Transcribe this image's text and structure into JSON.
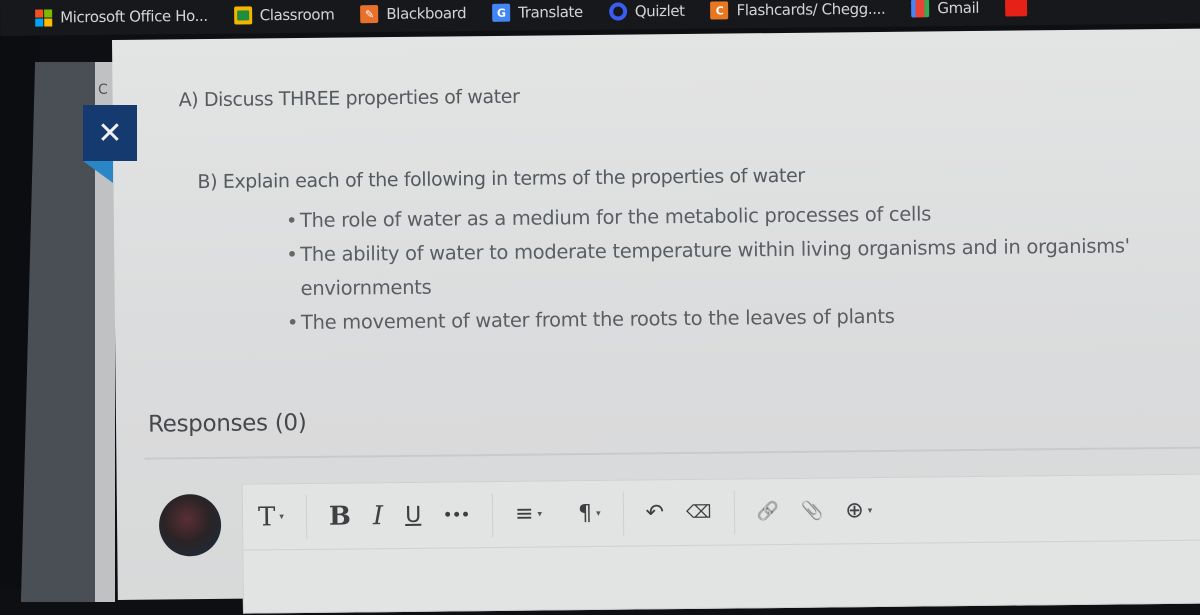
{
  "bookmarks": [
    {
      "label": "Microsoft Office Ho...",
      "icon": "microsoft-office-icon"
    },
    {
      "label": "Classroom",
      "icon": "google-classroom-icon"
    },
    {
      "label": "Blackboard",
      "icon": "blackboard-icon"
    },
    {
      "label": "Translate",
      "icon": "google-translate-icon"
    },
    {
      "label": "Quizlet",
      "icon": "quizlet-icon"
    },
    {
      "label": "Flashcards/ Chegg....",
      "icon": "chegg-icon"
    },
    {
      "label": "Gmail",
      "icon": "gmail-icon"
    }
  ],
  "icons": {
    "translate_glyph": "G",
    "chegg_glyph": "C",
    "close_glyph": "✕",
    "small_c": "C"
  },
  "question": {
    "part_a": "A) Discuss THREE properties of water",
    "part_b": "B) Explain each of the following in terms of the properties of water",
    "bullets": [
      "The role of water as a medium for the metabolic processes of cells",
      "The ability of water to moderate temperature within living organisms and in organisms' enviornments",
      "The movement of water fromt the roots to the leaves of plants"
    ]
  },
  "responses": {
    "label": "Responses (0)"
  },
  "toolbar": {
    "text_style": "T",
    "bold": "B",
    "italic": "I",
    "underline": "U",
    "more": "•••",
    "align": "≡",
    "paragraph": "¶",
    "undo": "↶",
    "clear_format": "⌫",
    "link": "🔗",
    "attach": "📎",
    "insert": "⊕",
    "caret": "▾"
  },
  "colors": {
    "close_button": "#143a70",
    "close_tab": "#2a86c4"
  }
}
